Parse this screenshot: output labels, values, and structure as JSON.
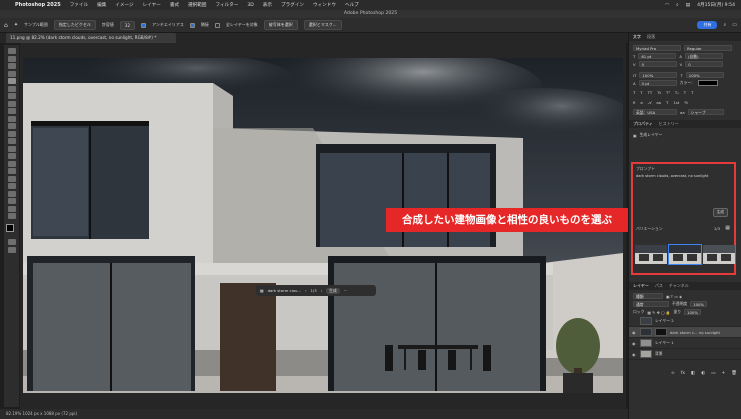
{
  "menubar": {
    "app_name": "Photoshop 2025",
    "items": [
      "ファイル",
      "編集",
      "イメージ",
      "レイヤー",
      "書式",
      "選択範囲",
      "フィルター",
      "3D",
      "表示",
      "プラグイン",
      "ウィンドウ",
      "ヘルプ"
    ],
    "clock": "4月15日(月) 9:54"
  },
  "window": {
    "title": "Adobe Photoshop 2025"
  },
  "options": {
    "sample_label": "サンプル範囲",
    "sample_value": "指定したピクセル",
    "tolerance_label": "許容値",
    "tolerance_value": "32",
    "antialias": "アンチエイリアス",
    "contiguous": "隣接",
    "all_layers": "全レイヤーを対象",
    "subject": "被写体を選択",
    "select_mask": "選択とマスク...",
    "share": "共有"
  },
  "document_tab": "11.png @ 82.2% (dark storm clouds, overcast, no sunlight, RGB/8#) *",
  "status": "82.19%    1024 px x 1088 px (72 ppi)",
  "panel_tabs": {
    "character": "文字",
    "paragraph": "段落"
  },
  "character": {
    "font": "Myriad Pro",
    "style": "Regular",
    "size": "61 pt",
    "leading": "(自動)",
    "kerning": "0",
    "tracking": "0",
    "vscale": "100%",
    "hscale": "100%",
    "baseline": "0 pt",
    "color_label": "カラー：",
    "lang": "英語：USA",
    "aa": "シャープ"
  },
  "props_tabs": {
    "properties": "プロパティ",
    "history": "ヒストリー"
  },
  "props_layer_type": "生成レイヤー",
  "gen": {
    "prompt_label": "プロンプト",
    "prompt": "dark storm clouds, overcast, no sunlight",
    "generate": "生成",
    "variations": "バリエーション",
    "count": "1/3"
  },
  "callout": "合成したい建物画像と相性の良いものを選ぶ",
  "ctxbar": {
    "layer": "dark storm clou...",
    "count": "1/3",
    "generate": "生成"
  },
  "layers": {
    "tabs": [
      "レイヤー",
      "パス",
      "チャンネル"
    ],
    "filter": "種類",
    "blend": "通常",
    "opacity_label": "不透明度",
    "opacity": "100%",
    "lock_label": "ロック",
    "fill_label": "塗り",
    "fill": "100%",
    "items": [
      {
        "name": "レイヤー 2",
        "visible": false
      },
      {
        "name": "dark storm c... no sunlight",
        "visible": true,
        "active": true
      },
      {
        "name": "レイヤー 1",
        "visible": true
      },
      {
        "name": "背景",
        "visible": true
      }
    ]
  },
  "colors": {
    "accent": "#2f6fe0",
    "highlight": "#e53b3b",
    "callout": "#e52727"
  }
}
